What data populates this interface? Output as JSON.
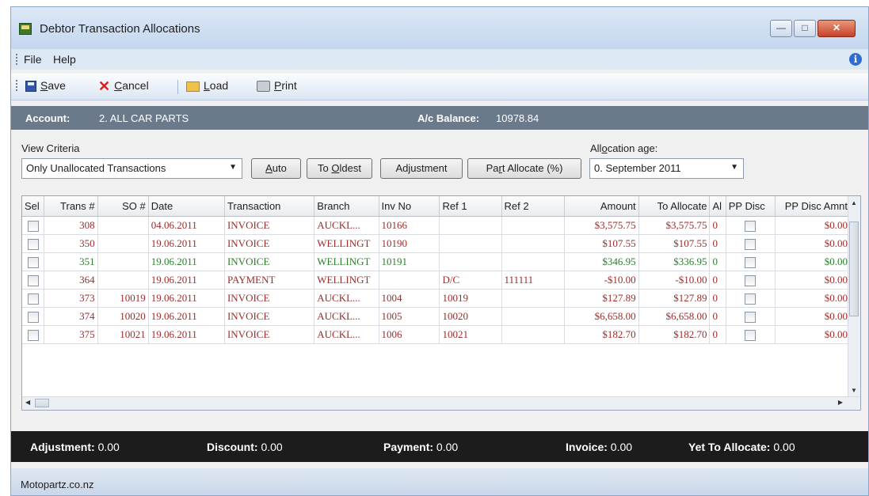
{
  "window": {
    "title": "Debtor Transaction Allocations"
  },
  "menu": {
    "items": [
      "File",
      "Help"
    ]
  },
  "toolbar": {
    "save": {
      "pre": "",
      "key": "S",
      "post": "ave"
    },
    "cancel": {
      "pre": "",
      "key": "C",
      "post": "ancel"
    },
    "load": {
      "pre": "",
      "key": "L",
      "post": "oad"
    },
    "print": {
      "pre": "",
      "key": "P",
      "post": "rint"
    }
  },
  "account": {
    "label": "Account:",
    "value": "2. ALL CAR PARTS",
    "balance_label": "A/c Balance:",
    "balance_value": "10978.84"
  },
  "criteria": {
    "view_label": "View Criteria",
    "view_value": "Only Unallocated Transactions",
    "alloc_label": {
      "pre": "All",
      "key": "o",
      "post": "cation age:"
    },
    "alloc_value": "0. September 2011"
  },
  "buttons": {
    "auto": {
      "pre": "",
      "key": "A",
      "post": "uto"
    },
    "oldest": {
      "pre": "To ",
      "key": "O",
      "post": "ldest"
    },
    "adjustment": {
      "pre": "Ad",
      "key": "j",
      "post": "ustment"
    },
    "part": {
      "pre": "Pa",
      "key": "r",
      "post": "t Allocate (%)"
    }
  },
  "grid": {
    "columns": [
      "Sel",
      "Trans #",
      "SO #",
      "Date",
      "Transaction",
      "Branch",
      "Inv No",
      "Ref 1",
      "Ref 2",
      "Amount",
      "To Allocate",
      "Al",
      "PP Disc",
      "PP Disc Amnt"
    ],
    "rows": [
      {
        "color": "#9b2d2d",
        "trans": "308",
        "so": "",
        "date": "04.06.2011",
        "transaction": "INVOICE",
        "branch": "AUCKL...",
        "inv": "10166",
        "ref1": "",
        "ref2": "",
        "amount": "$3,575.75",
        "to_allocate": "$3,575.75",
        "al": "0",
        "pp_amnt": "$0.00"
      },
      {
        "color": "#9b2d2d",
        "trans": "350",
        "so": "",
        "date": "19.06.2011",
        "transaction": "INVOICE",
        "branch": "WELLINGT",
        "inv": "10190",
        "ref1": "",
        "ref2": "",
        "amount": "$107.55",
        "to_allocate": "$107.55",
        "al": "0",
        "pp_amnt": "$0.00"
      },
      {
        "color": "#2e7d2e",
        "trans": "351",
        "so": "",
        "date": "19.06.2011",
        "transaction": "INVOICE",
        "branch": "WELLINGT",
        "inv": "10191",
        "ref1": "",
        "ref2": "",
        "amount": "$346.95",
        "to_allocate": "$336.95",
        "al": "0",
        "pp_amnt": "$0.00"
      },
      {
        "color": "#9b2d2d",
        "trans": "364",
        "so": "",
        "date": "19.06.2011",
        "transaction": "PAYMENT",
        "branch": "WELLINGT",
        "inv": "",
        "ref1": "D/C",
        "ref2": "111111",
        "amount": "-$10.00",
        "to_allocate": "-$10.00",
        "al": "0",
        "pp_amnt": "$0.00"
      },
      {
        "color": "#9b2d2d",
        "trans": "373",
        "so": "10019",
        "date": "19.06.2011",
        "transaction": "INVOICE",
        "branch": "AUCKL...",
        "inv": "1004",
        "ref1": "10019",
        "ref2": "",
        "amount": "$127.89",
        "to_allocate": "$127.89",
        "al": "0",
        "pp_amnt": "$0.00"
      },
      {
        "color": "#9b2d2d",
        "trans": "374",
        "so": "10020",
        "date": "19.06.2011",
        "transaction": "INVOICE",
        "branch": "AUCKL...",
        "inv": "1005",
        "ref1": "10020",
        "ref2": "",
        "amount": "$6,658.00",
        "to_allocate": "$6,658.00",
        "al": "0",
        "pp_amnt": "$0.00"
      },
      {
        "color": "#9b2d2d",
        "trans": "375",
        "so": "10021",
        "date": "19.06.2011",
        "transaction": "INVOICE",
        "branch": "AUCKL...",
        "inv": "1006",
        "ref1": "10021",
        "ref2": "",
        "amount": "$182.70",
        "to_allocate": "$182.70",
        "al": "0",
        "pp_amnt": "$0.00"
      }
    ]
  },
  "totals": {
    "adjustment_label": "Adjustment:",
    "adjustment_value": "0.00",
    "discount_label": "Discount:",
    "discount_value": "0.00",
    "payment_label": "Payment:",
    "payment_value": "0.00",
    "invoice_label": "Invoice:",
    "invoice_value": "0.00",
    "yet_label": "Yet To Allocate:",
    "yet_value": "0.00"
  },
  "status": {
    "text": "Motopartz.co.nz"
  }
}
